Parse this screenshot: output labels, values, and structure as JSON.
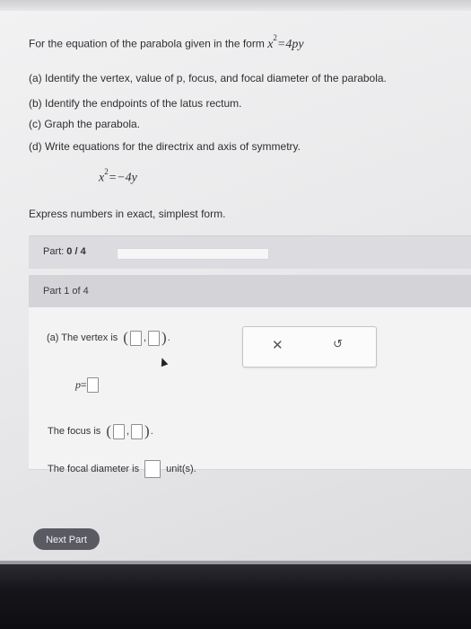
{
  "problem": {
    "intro": "For the equation of the parabola given in the form",
    "form_lhs": "x",
    "form_exp": "2",
    "form_rhs": "=4py",
    "parts": [
      "(a) Identify the vertex, value of p, focus, and focal diameter of the parabola.",
      "(b) Identify the endpoints of the latus rectum.",
      "(c) Graph the parabola.",
      "(d) Write equations for the directrix and axis of symmetry."
    ],
    "equation_lhs": "x",
    "equation_exp": "2",
    "equation_rhs": "=−4y",
    "instruction": "Express numbers in exact, simplest form."
  },
  "progress": {
    "label": "Part:",
    "current": "0",
    "separator": "/",
    "total": "4",
    "fraction": 0.0
  },
  "part_header": "Part 1 of 4",
  "answers": {
    "vertex_label": "(a) The vertex is",
    "p_label": "p",
    "p_eq": "=",
    "focus_label": "The focus is",
    "diameter_label": "The focal diameter is",
    "diameter_unit": "unit(s)."
  },
  "tools": {
    "clear_icon": "✕",
    "undo_icon": "↺"
  },
  "next_button": "Next Part"
}
